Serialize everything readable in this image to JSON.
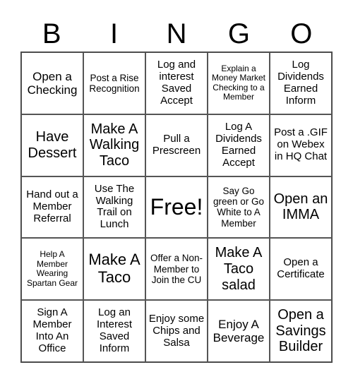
{
  "header": [
    "B",
    "I",
    "N",
    "G",
    "O"
  ],
  "cells": [
    [
      "Open a Checking",
      "Post a Rise Recognition",
      "Log and interest Saved Accept",
      "Explain a Money Market Checking to a Member",
      "Log Dividends Earned Inform"
    ],
    [
      "Have Dessert",
      "Make A Walking Taco",
      "Pull a Prescreen",
      "Log A Dividends Earned Accept",
      "Post a .GIF on Webex in HQ Chat"
    ],
    [
      "Hand out a Member Referral",
      "Use The Walking Trail on Lunch",
      "Free!",
      "Say Go green or Go White to A Member",
      "Open an IMMA"
    ],
    [
      "Help A Member Wearing Spartan Gear",
      "Make A Taco",
      "Offer a Non-Member to Join the CU",
      "Make A Taco salad",
      "Open a Certificate"
    ],
    [
      "Sign A Member Into An Office",
      "Log an Interest Saved Inform",
      "Enjoy some Chips and Salsa",
      "Enjoy A Beverage",
      "Open a Savings Builder"
    ]
  ]
}
